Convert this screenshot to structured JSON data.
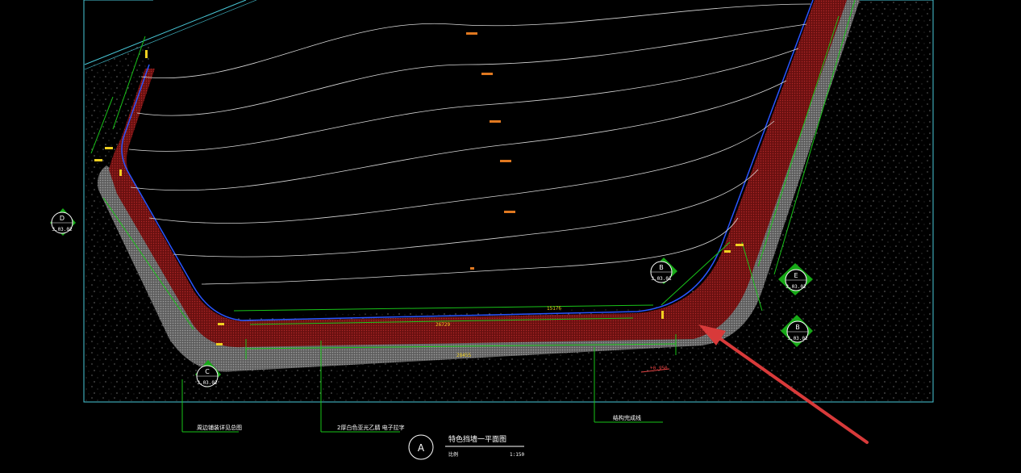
{
  "drawing": {
    "title": "特色挡墙一平面图",
    "scale_label": "比例",
    "scale_value": "1:150",
    "view_mark": "A"
  },
  "callouts": [
    {
      "id": "c1",
      "text": "周边铺装详见总图"
    },
    {
      "id": "c2",
      "text": "2厚白色亚光乙腈  电子拉字"
    },
    {
      "id": "c3",
      "text": "结构完成线"
    }
  ],
  "section_markers": [
    {
      "id": "m-d",
      "letter": "D",
      "ref": "3.03.02"
    },
    {
      "id": "m-b1",
      "letter": "B",
      "ref": "3.03.01"
    },
    {
      "id": "m-e",
      "letter": "E",
      "ref": "3.03.02"
    },
    {
      "id": "m-b2",
      "letter": "B",
      "ref": "3.03.02"
    },
    {
      "id": "m-c",
      "letter": "C",
      "ref": "3.03.02"
    }
  ],
  "dimensions": [
    {
      "id": "d-top",
      "text": "15176"
    },
    {
      "id": "d-mid",
      "text": "26729"
    },
    {
      "id": "d-bot",
      "text": "28455"
    },
    {
      "id": "d-level",
      "text": "+0.950"
    }
  ],
  "colors": {
    "background": "#000000",
    "frame": "#48c8d8",
    "wall_fill": "#7a1414",
    "paving": "#8c8c8c",
    "dim_line": "#19c419",
    "contour": "#d8d8d8",
    "edge": "#2a55ff",
    "annotation": "#f0d020",
    "arrow": "#e04040"
  }
}
